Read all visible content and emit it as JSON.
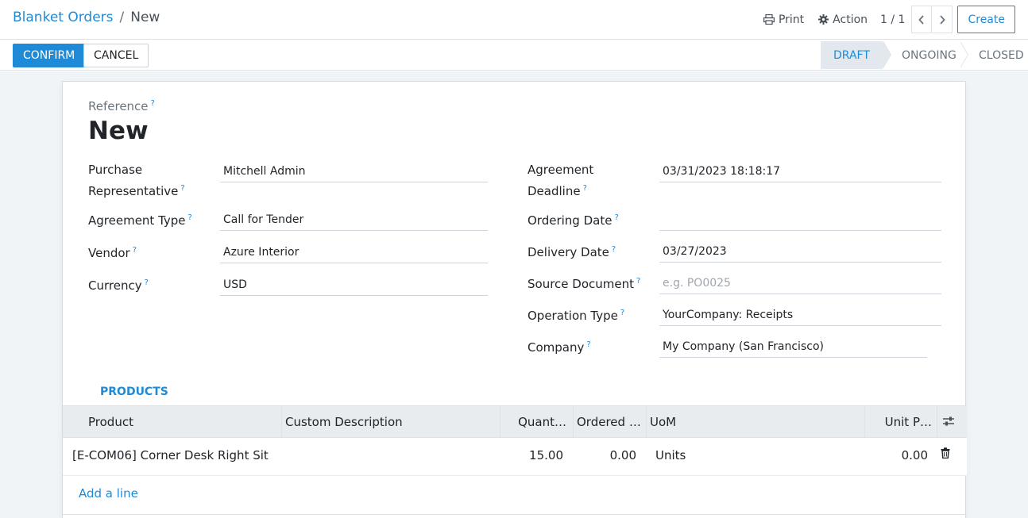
{
  "breadcrumb": {
    "parent": "Blanket Orders",
    "separator": "/",
    "current": "New"
  },
  "toolbar": {
    "print_label": "Print",
    "action_label": "Action",
    "pager_value": "1 / 1",
    "create_label": "Create"
  },
  "actions": {
    "confirm_label": "CONFIRM",
    "cancel_label": "CANCEL"
  },
  "statusbar": {
    "stages": [
      "DRAFT",
      "ONGOING",
      "CLOSED"
    ],
    "active": "DRAFT"
  },
  "form": {
    "reference_label": "Reference",
    "reference_value": "New",
    "help_mark": "?",
    "left_fields": {
      "purchase_rep_label_1": "Purchase",
      "purchase_rep_label_2": "Representative",
      "purchase_rep_value": "Mitchell Admin",
      "agreement_type_label": "Agreement Type",
      "agreement_type_value": "Call for Tender",
      "vendor_label": "Vendor",
      "vendor_value": "Azure Interior",
      "currency_label": "Currency",
      "currency_value": "USD"
    },
    "right_fields": {
      "deadline_label_1": "Agreement",
      "deadline_label_2": "Deadline",
      "deadline_value": "03/31/2023 18:18:17",
      "ordering_date_label": "Ordering Date",
      "ordering_date_value": "",
      "delivery_date_label": "Delivery Date",
      "delivery_date_value": "03/27/2023",
      "source_doc_label": "Source Document",
      "source_doc_placeholder": "e.g. PO0025",
      "operation_type_label": "Operation Type",
      "operation_type_value": "YourCompany: Receipts",
      "company_label": "Company",
      "company_value": "My Company (San Francisco)"
    }
  },
  "tabs": {
    "products_label": "PRODUCTS"
  },
  "table": {
    "headers": {
      "product": "Product",
      "custom_description": "Custom Description",
      "quantity": "Quant…",
      "ordered_qty": "Ordered Q…",
      "uom": "UoM",
      "unit_price": "Unit P…"
    },
    "rows": [
      {
        "product": "[E-COM06] Corner Desk Right Sit",
        "custom_description": "",
        "quantity": "15.00",
        "ordered_qty": "0.00",
        "uom": "Units",
        "unit_price": "0.00"
      }
    ],
    "add_line_label": "Add a line"
  },
  "colors": {
    "accent": "#1f8ad6",
    "active_stage_bg": "#e2e8ee"
  }
}
